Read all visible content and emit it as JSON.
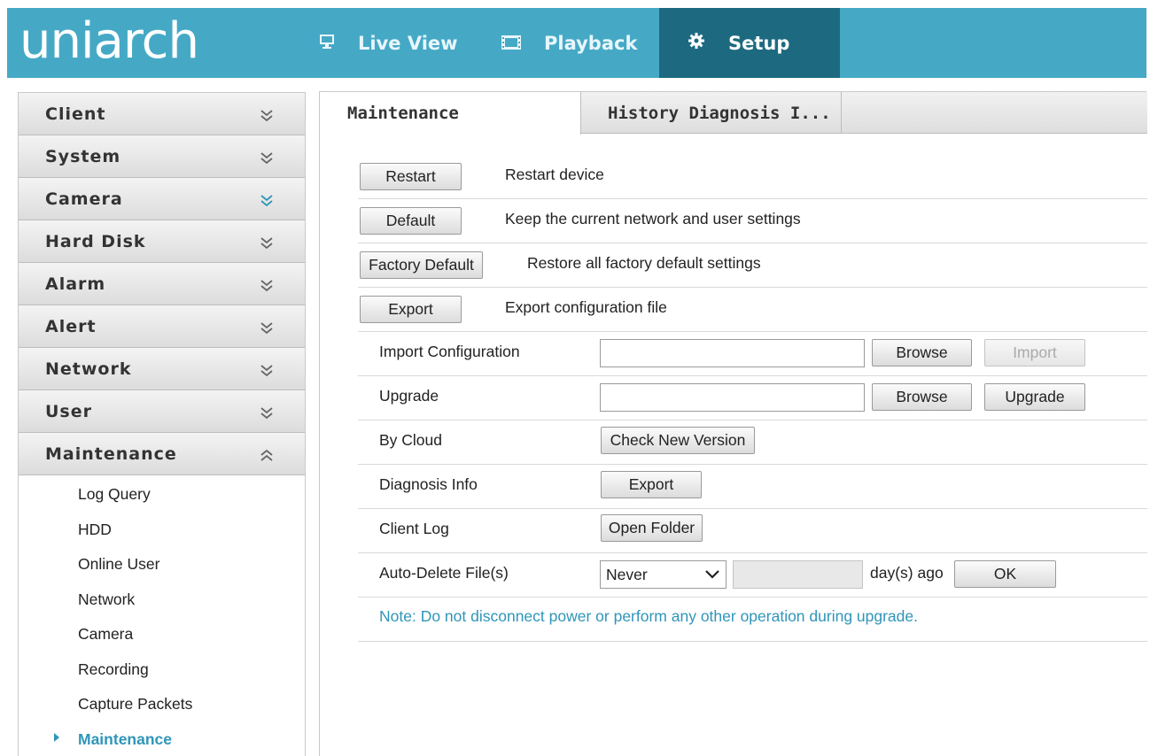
{
  "app": {
    "logo_text": "uniarch",
    "nav": [
      {
        "label": "Live View",
        "icon": "monitor-icon"
      },
      {
        "label": "Playback",
        "icon": "film-icon"
      },
      {
        "label": "Setup",
        "icon": "gear-icon",
        "active": true
      }
    ],
    "colors": {
      "topbar": "#45a9c6",
      "setup_active": "#1d6a80",
      "accent": "#2f95b9"
    }
  },
  "sidebar": {
    "sections": [
      {
        "label": "Client",
        "expanded": false
      },
      {
        "label": "System",
        "expanded": false
      },
      {
        "label": "Camera",
        "expanded": false,
        "highlighted_chevron": true
      },
      {
        "label": "Hard Disk",
        "expanded": false
      },
      {
        "label": "Alarm",
        "expanded": false
      },
      {
        "label": "Alert",
        "expanded": false
      },
      {
        "label": "Network",
        "expanded": false
      },
      {
        "label": "User",
        "expanded": false
      },
      {
        "label": "Maintenance",
        "expanded": true
      }
    ],
    "maintenance_items": [
      "Log Query",
      "HDD",
      "Online User",
      "Network",
      "Camera",
      "Recording",
      "Capture Packets",
      "Maintenance"
    ],
    "active_item": "Maintenance"
  },
  "tabs": [
    {
      "label": "Maintenance",
      "active": true
    },
    {
      "label": "History Diagnosis I..."
    }
  ],
  "actions": {
    "restart": {
      "button": "Restart",
      "desc": "Restart device"
    },
    "default": {
      "button": "Default",
      "desc": "Keep the current network and user settings"
    },
    "factory": {
      "button": "Factory Default",
      "desc": "Restore all factory default settings"
    },
    "export": {
      "button": "Export",
      "desc": "Export configuration file"
    }
  },
  "import_config": {
    "label": "Import Configuration",
    "value": "",
    "browse": "Browse",
    "import": "Import"
  },
  "upgrade": {
    "label": "Upgrade",
    "value": "",
    "browse": "Browse",
    "upgrade": "Upgrade"
  },
  "cloud": {
    "label": "By Cloud",
    "button": "Check New Version"
  },
  "diagnosis": {
    "label": "Diagnosis Info",
    "button": "Export"
  },
  "client_log": {
    "label": "Client Log",
    "button": "Open Folder"
  },
  "auto_delete": {
    "label": "Auto-Delete File(s)",
    "selected": "Never",
    "days_value": "",
    "unit": "day(s) ago",
    "ok": "OK"
  },
  "note": "Note: Do not disconnect power or perform any other operation during upgrade."
}
